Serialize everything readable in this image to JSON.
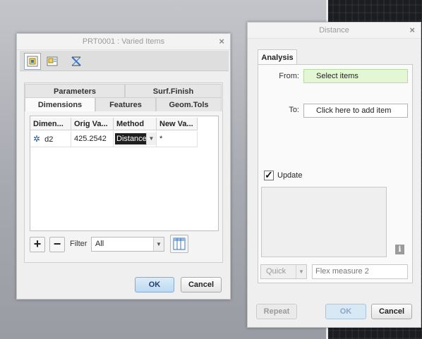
{
  "varied_items": {
    "title": "PRT0001 : Varied Items",
    "tabs_row1": [
      "Parameters",
      "Surf.Finish"
    ],
    "tabs_row2": [
      "Dimensions",
      "Features",
      "Geom.Tols"
    ],
    "columns": [
      "Dimen...",
      "Orig Va...",
      "Method",
      "New Va..."
    ],
    "rows": [
      {
        "dimension": "d2",
        "orig_value": "425.2542",
        "method": "Distance",
        "new_value": "*"
      }
    ],
    "filter_label": "Filter",
    "filter_value": "All",
    "ok_label": "OK",
    "cancel_label": "Cancel"
  },
  "distance": {
    "title": "Distance",
    "tab": "Analysis",
    "from_label": "From:",
    "from_value": "Select items",
    "to_label": "To:",
    "to_value": "Click here to add item",
    "update_label": "Update",
    "update_checked": true,
    "info_glyph": "i",
    "quick_label": "Quick",
    "name_value": "Flex measure 2",
    "repeat_label": "Repeat",
    "ok_label": "OK",
    "cancel_label": "Cancel"
  },
  "colors": {
    "from_field_bg": "#e3f7d4",
    "primary_button": "#bcd9f2",
    "dim_icon": "#1f4f8f"
  },
  "icons": [
    "close-icon",
    "dimensions-view-icon",
    "table-view-icon",
    "relations-icon",
    "dimension-star-icon",
    "add-icon",
    "remove-icon",
    "columns-icon",
    "info-icon",
    "checkmark-icon"
  ]
}
